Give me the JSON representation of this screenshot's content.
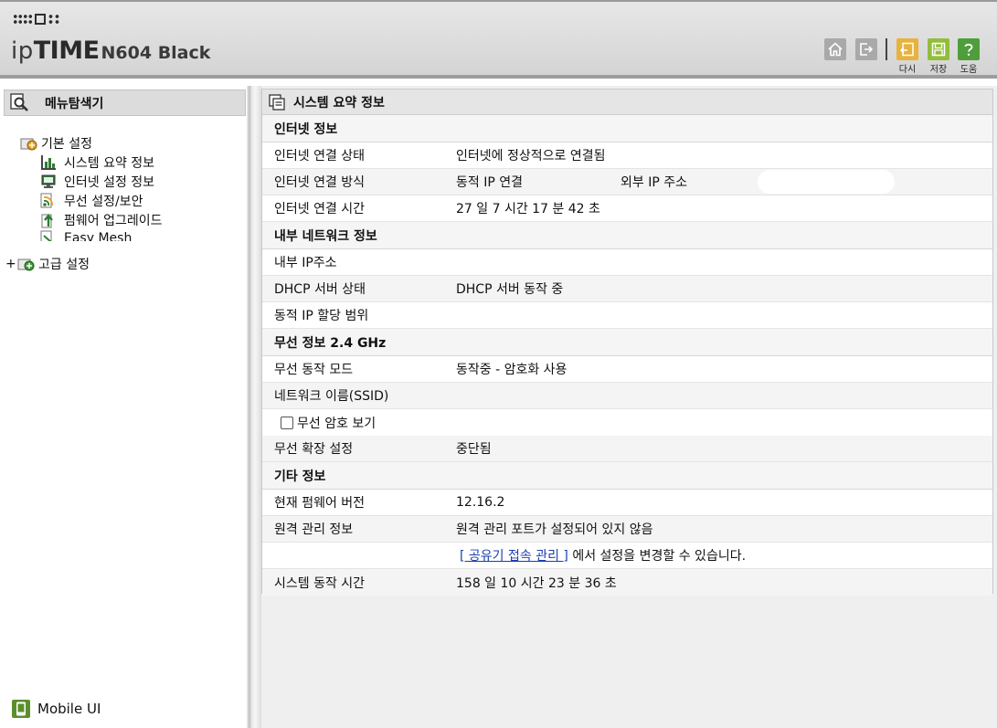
{
  "header": {
    "brand_ip": "ip",
    "brand_time": "TIME",
    "model": "N604 Black",
    "toolbar": {
      "reapply_label": "다시",
      "save_label": "저장",
      "help_label": "도움"
    },
    "colors": {
      "reapply": "#e8b23e",
      "save": "#92bd3c",
      "help": "#4e9e3c"
    }
  },
  "nav": {
    "title": "메뉴탐색기",
    "groups": [
      {
        "label": "기본 설정",
        "expanded": true,
        "items": [
          {
            "label": "시스템 요약 정보",
            "icon": "bar-chart-icon"
          },
          {
            "label": "인터넷 설정 정보",
            "icon": "monitor-icon"
          },
          {
            "label": "무선 설정/보안",
            "icon": "wifi-icon"
          },
          {
            "label": "펌웨어 업그레이드",
            "icon": "upload-icon"
          },
          {
            "label": "Easy Mesh",
            "icon": "mesh-icon"
          }
        ]
      },
      {
        "label": "고급 설정",
        "expanded": false,
        "expander": "+"
      }
    ],
    "mobile_label": "Mobile UI"
  },
  "panel": {
    "title": "시스템 요약 정보",
    "sections": {
      "internet": {
        "title": "인터넷 정보",
        "status_label": "인터넷 연결 상태",
        "status_value": "인터넷에 정상적으로 연결됨",
        "method_label": "인터넷 연결 방식",
        "method_value": "동적 IP 연결",
        "external_ip_label": "외부 IP 주소",
        "uptime_label": "인터넷 연결 시간",
        "uptime_value": "27 일 7 시간 17 분 42 초"
      },
      "lan": {
        "title": "내부 네트워크 정보",
        "ip_label": "내부 IP주소",
        "dhcp_label": "DHCP 서버 상태",
        "dhcp_value": "DHCP 서버 동작 중",
        "range_label": "동적 IP 할당 범위"
      },
      "wireless": {
        "title": "무선 정보 2.4 GHz",
        "mode_label": "무선 동작 모드",
        "mode_value": "동작중 - 암호화 사용",
        "ssid_label": "네트워크 이름(SSID)",
        "show_password_label": "무선 암호 보기",
        "extender_label": "무선 확장 설정",
        "extender_value": "중단됨"
      },
      "other": {
        "title": "기타 정보",
        "firmware_label": "현재 펌웨어 버전",
        "firmware_value": "12.16.2",
        "remote_label": "원격 관리 정보",
        "remote_value": "원격 관리 포트가 설정되어 있지 않음",
        "remote_link": "[ 공유기 접속 관리 ]",
        "remote_hint": " 에서 설정을 변경할 수 있습니다.",
        "system_uptime_label": "시스템 동작 시간",
        "system_uptime_value": "158 일 10 시간 23 분 36 초"
      }
    }
  }
}
